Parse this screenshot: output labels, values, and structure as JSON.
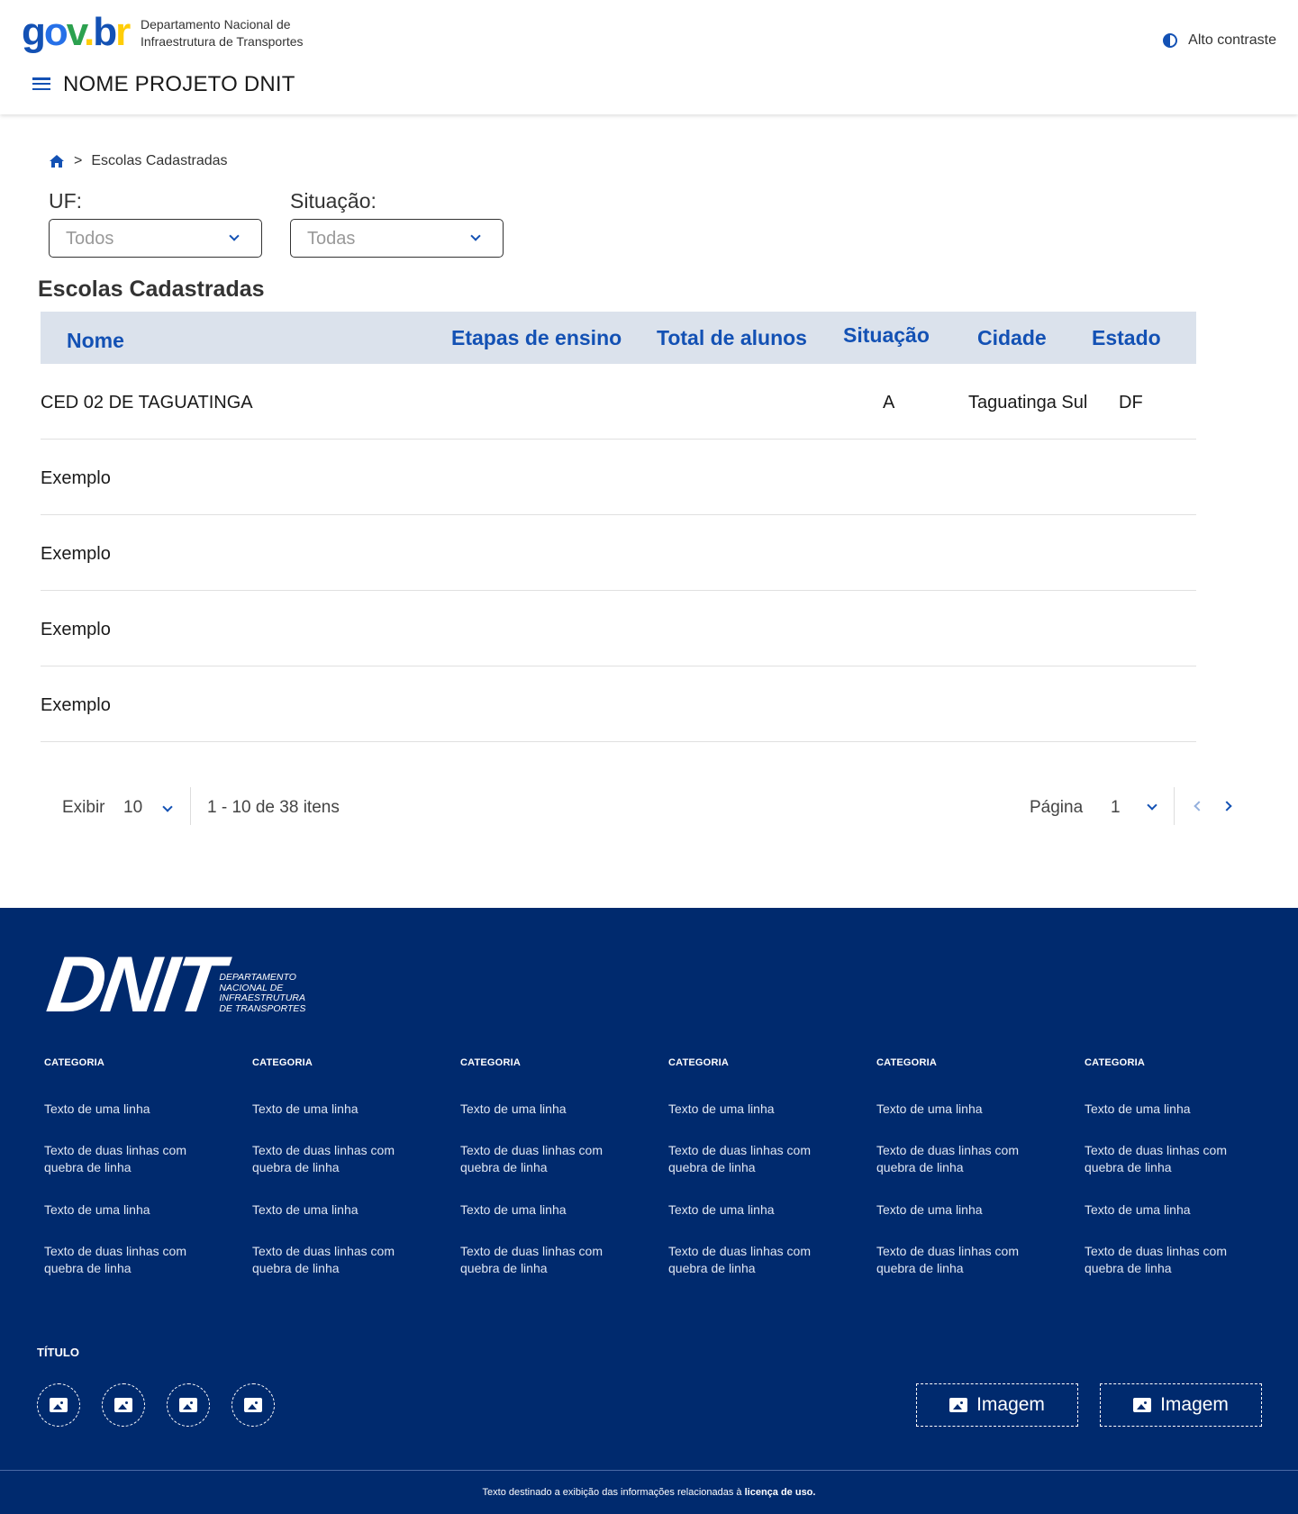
{
  "header": {
    "logo": {
      "g": "g",
      "o": "o",
      "v": "v",
      "dot": ".",
      "b": "b",
      "r": "r"
    },
    "department_line1": "Departamento Nacional de",
    "department_line2": "Infraestrutura de Transportes",
    "contrast_label": "Alto contraste",
    "project_name": "NOME PROJETO DNIT"
  },
  "breadcrumb": {
    "separator": ">",
    "current": "Escolas Cadastradas"
  },
  "filters": {
    "uf_label": "UF:",
    "uf_value": "Todos",
    "situacao_label": "Situação:",
    "situacao_value": "Todas"
  },
  "table": {
    "title": "Escolas Cadastradas",
    "columns": [
      "Nome",
      "Etapas de ensino",
      "Total de alunos",
      "Situação",
      "Cidade",
      "Estado"
    ],
    "rows": [
      {
        "nome": "CED 02 DE TAGUATINGA",
        "etapas": "",
        "total": "",
        "situacao": "A",
        "cidade": "Taguatinga Sul",
        "estado": "DF"
      },
      {
        "nome": "Exemplo",
        "etapas": "",
        "total": "",
        "situacao": "",
        "cidade": "",
        "estado": ""
      },
      {
        "nome": "Exemplo",
        "etapas": "",
        "total": "",
        "situacao": "",
        "cidade": "",
        "estado": ""
      },
      {
        "nome": "Exemplo",
        "etapas": "",
        "total": "",
        "situacao": "",
        "cidade": "",
        "estado": ""
      },
      {
        "nome": "Exemplo",
        "etapas": "",
        "total": "",
        "situacao": "",
        "cidade": "",
        "estado": ""
      }
    ]
  },
  "pagination": {
    "show_label": "Exibir",
    "page_size": "10",
    "range_text": "1 - 10 de 38 itens",
    "page_label": "Página",
    "current_page": "1"
  },
  "footer": {
    "logo_text": "DNIT",
    "logo_sub1": "DEPARTAMENTO",
    "logo_sub2": "NACIONAL DE",
    "logo_sub3": "INFRAESTRUTURA",
    "logo_sub4": "DE TRANSPORTES",
    "columns": [
      {
        "category": "CATEGORIA",
        "links": [
          "Texto de uma linha",
          "Texto de duas linhas com quebra de linha",
          "Texto de uma linha",
          "Texto de duas linhas com quebra de linha"
        ]
      },
      {
        "category": "CATEGORIA",
        "links": [
          "Texto de uma linha",
          "Texto de duas linhas com quebra de linha",
          "Texto de uma linha",
          "Texto de duas linhas com quebra de linha"
        ]
      },
      {
        "category": "CATEGORIA",
        "links": [
          "Texto de uma linha",
          "Texto de duas linhas com quebra de linha",
          "Texto de uma linha",
          "Texto de duas linhas com quebra de linha"
        ]
      },
      {
        "category": "CATEGORIA",
        "links": [
          "Texto de uma linha",
          "Texto de duas linhas com quebra de linha",
          "Texto de uma linha",
          "Texto de duas linhas com quebra de linha"
        ]
      },
      {
        "category": "CATEGORIA",
        "links": [
          "Texto de uma linha",
          "Texto de duas linhas com quebra de linha",
          "Texto de uma linha",
          "Texto de duas linhas com quebra de linha"
        ]
      },
      {
        "category": "CATEGORIA",
        "links": [
          "Texto de uma linha",
          "Texto de duas linhas com quebra de linha",
          "Texto de uma linha",
          "Texto de duas linhas com quebra de linha"
        ]
      }
    ],
    "social_title": "TÍTULO",
    "image_label_1": "Imagem",
    "image_label_2": "Imagem",
    "license_text": "Texto destinado a exibição das informações relacionadas à ",
    "license_bold": "licença de uso."
  },
  "colors": {
    "primary": "#1351b4",
    "footer_bg": "#002a6e",
    "table_header_bg": "#dbe2ec"
  },
  "icons": [
    "menu-icon",
    "contrast-icon",
    "home-icon",
    "chevron-down-icon",
    "chevron-left-icon",
    "chevron-right-icon",
    "image-icon"
  ]
}
